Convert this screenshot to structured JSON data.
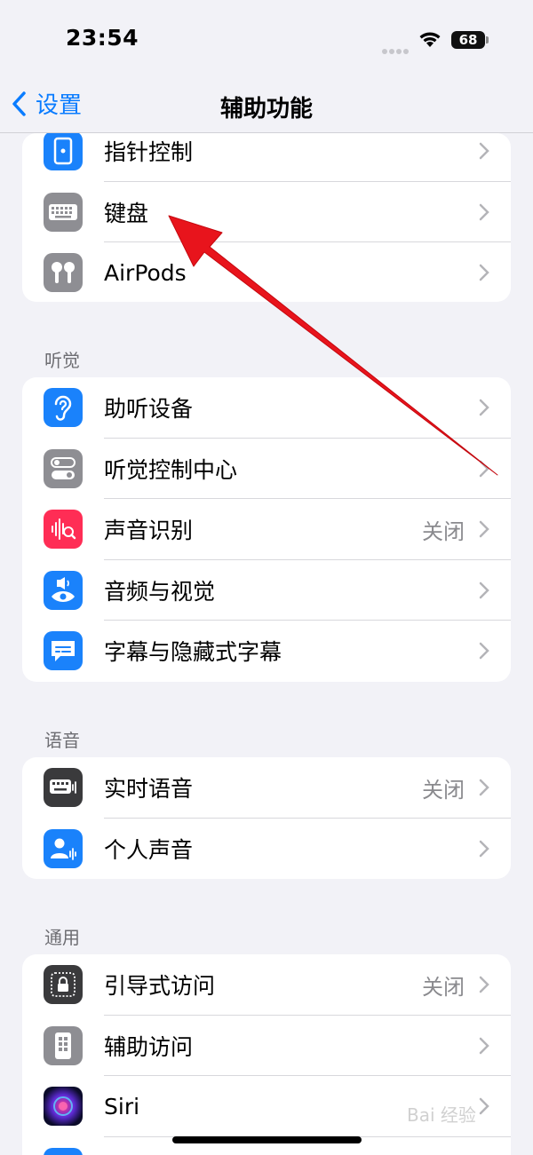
{
  "status": {
    "time": "23:54",
    "battery": "68"
  },
  "nav": {
    "back_label": "设置",
    "title": "辅助功能"
  },
  "group_top": {
    "items": [
      {
        "label": "指针控制",
        "value": ""
      },
      {
        "label": "键盘",
        "value": ""
      },
      {
        "label": "AirPods",
        "value": ""
      }
    ]
  },
  "hearing": {
    "header": "听觉",
    "items": [
      {
        "label": "助听设备",
        "value": ""
      },
      {
        "label": "听觉控制中心",
        "value": ""
      },
      {
        "label": "声音识别",
        "value": "关闭"
      },
      {
        "label": "音频与视觉",
        "value": ""
      },
      {
        "label": "字幕与隐藏式字幕",
        "value": ""
      }
    ]
  },
  "speech": {
    "header": "语音",
    "items": [
      {
        "label": "实时语音",
        "value": "关闭"
      },
      {
        "label": "个人声音",
        "value": ""
      }
    ]
  },
  "general": {
    "header": "通用",
    "items": [
      {
        "label": "引导式访问",
        "value": "关闭"
      },
      {
        "label": "辅助访问",
        "value": ""
      },
      {
        "label": "Siri",
        "value": ""
      }
    ]
  },
  "watermark": "Bai 经验",
  "colors": {
    "accent": "#0a7cff",
    "icon_blue": "#1a82fb",
    "icon_gray": "#8e8e93",
    "icon_pink": "#ff2d55",
    "icon_dark": "#3a3a3c",
    "annotation_arrow": "#e8141c"
  }
}
